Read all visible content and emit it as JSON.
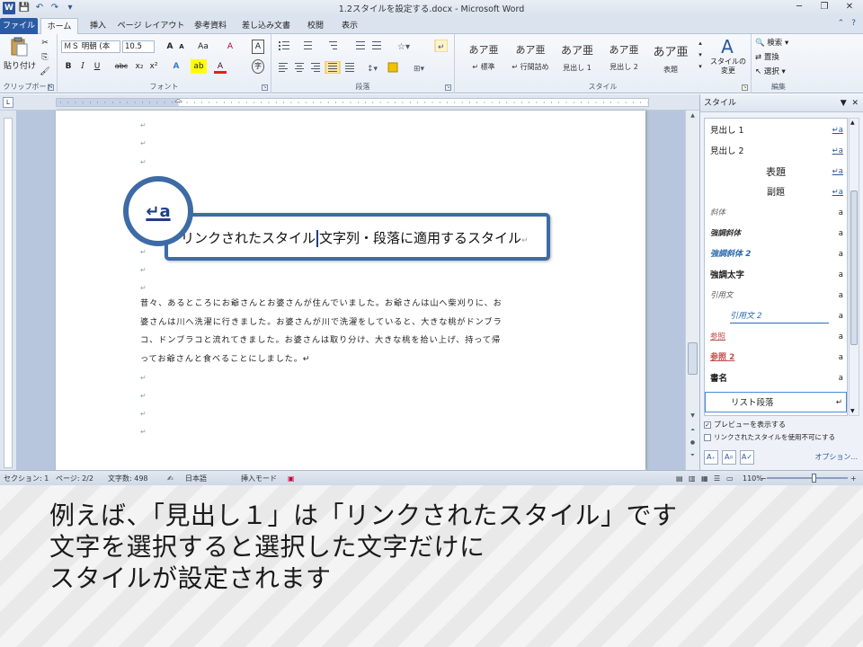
{
  "titlebar": {
    "title": "1.2スタイルを設定する.docx - Microsoft Word",
    "word_icon": "W",
    "save_icon": "💾",
    "undo_icon": "↶",
    "redo_icon": "↷",
    "qat_more": "▾",
    "minimize": "─",
    "restore": "❐",
    "close": "✕"
  },
  "tabs": [
    "ファイル",
    "ホーム",
    "挿入",
    "ページ レイアウト",
    "参考資料",
    "差し込み文書",
    "校閲",
    "表示"
  ],
  "ribbon": {
    "clipboard": {
      "label": "クリップボード",
      "paste": "貼り付け",
      "cut": "✂",
      "copy": "⎘",
      "format_painter": "🖌"
    },
    "font": {
      "label": "フォント",
      "font_name": "ＭＳ 明朝 (本",
      "font_size": "10.5",
      "grow": "A",
      "shrink": "A",
      "case": "Aa",
      "clear": "A",
      "bold": "B",
      "italic": "I",
      "underline": "U",
      "strike": "abc",
      "sub": "x₂",
      "sup": "x²",
      "effects": "A",
      "highlight": "ab",
      "color": "A",
      "char_border": "A",
      "enclosed": "字"
    },
    "paragraph": {
      "label": "段落"
    },
    "styles": {
      "label": "スタイル",
      "items": [
        {
          "sample": "あア亜",
          "name": "↵ 標準"
        },
        {
          "sample": "あア亜",
          "name": "↵ 行間詰め"
        },
        {
          "sample": "あア亜",
          "name": "見出し 1"
        },
        {
          "sample": "あア亜",
          "name": "見出し 2"
        },
        {
          "sample": "あア亜",
          "name": "表題"
        }
      ],
      "change_line1": "スタイルの",
      "change_line2": "変更"
    },
    "editing": {
      "label": "編集",
      "find": "検索",
      "replace": "置換",
      "select": "選択"
    }
  },
  "document": {
    "paragraph_mark": "↵",
    "body_lines": [
      "昔々、あるところにお爺さんとお婆さんが住んでいました。お爺さんは山へ柴刈りに、お",
      "婆さんは川へ洗濯に行きました。お婆さんが川で洗濯をしていると、大きな桃がドンブラ",
      "コ、ドンブラコと流れてきました。お婆さんは取り分け、大きな桃を拾い上げ、持って帰",
      "ってお爺さんと食べることにしました。↵"
    ],
    "callout_icon": "↵a",
    "callout_text_a": "リンクされたスタイル",
    "callout_text_b": "文字列・段落に適用するスタイル",
    "callout_end": "↵"
  },
  "styles_pane": {
    "title": "スタイル",
    "items": [
      {
        "name": "見出し 1",
        "mark": "↵a"
      },
      {
        "name": "見出し 2",
        "mark": "↵a"
      },
      {
        "name": "表題",
        "mark": "↵a"
      },
      {
        "name": "副題",
        "mark": "↵a"
      },
      {
        "name": "斜体",
        "mark": "a"
      },
      {
        "name": "強調斜体",
        "mark": "a"
      },
      {
        "name": "強調斜体 2",
        "mark": "a"
      },
      {
        "name": "強調太字",
        "mark": "a"
      },
      {
        "name": "引用文",
        "mark": "a"
      },
      {
        "name": "引用文 2",
        "mark": "a"
      },
      {
        "name": "参照",
        "mark": "a"
      },
      {
        "name": "参照 2",
        "mark": "a"
      },
      {
        "name": "書名",
        "mark": "a"
      },
      {
        "name": "リスト段落",
        "mark": "↵"
      }
    ],
    "preview_label": "プレビューを表示する",
    "disable_linked_label": "リンクされたスタイルを使用不可にする",
    "options": "オプション..."
  },
  "statusbar": {
    "section": "セクション: 1",
    "page": "ページ: 2/2",
    "words": "文字数: 498",
    "language": "日本語",
    "mode": "挿入モード",
    "zoom": "110%"
  },
  "caption": {
    "line1": "例えば、「見出し１」は「リンクされたスタイル」です",
    "line2": "文字を選択すると選択した文字だけに",
    "line3": "スタイルが設定されます"
  }
}
